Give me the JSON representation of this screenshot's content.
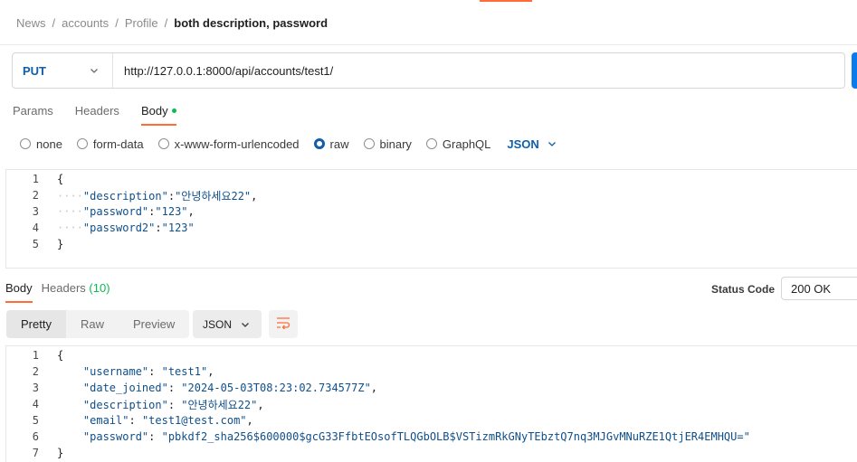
{
  "breadcrumb": {
    "items": [
      "News",
      "accounts",
      "Profile"
    ],
    "separator": "/",
    "current": "both description, password"
  },
  "request": {
    "method": "PUT",
    "url": "http://127.0.0.1:8000/api/accounts/test1/"
  },
  "request_tabs": {
    "params": "Params",
    "headers": "Headers",
    "body": "Body"
  },
  "body_types": {
    "none": "none",
    "form_data": "form-data",
    "urlencoded": "x-www-form-urlencoded",
    "raw": "raw",
    "binary": "binary",
    "graphql": "GraphQL",
    "format": "JSON",
    "selected": "raw"
  },
  "request_body": {
    "line_numbers": [
      "1",
      "2",
      "3",
      "4",
      "5"
    ],
    "open": "{",
    "close": "}",
    "fields": [
      {
        "key": "\"description\"",
        "value": "\"안녕하세요22\"",
        "comma": ","
      },
      {
        "key": "\"password\"",
        "value": "\"123\"",
        "comma": ","
      },
      {
        "key": "\"password2\"",
        "value": "\"123\"",
        "comma": ""
      }
    ]
  },
  "response_tabs": {
    "body": "Body",
    "headers": "Headers",
    "headers_count": "(10)"
  },
  "status": {
    "label": "Status Code",
    "value": "200 OK"
  },
  "view_modes": {
    "pretty": "Pretty",
    "raw": "Raw",
    "preview": "Preview",
    "format": "JSON"
  },
  "response_body": {
    "line_numbers": [
      "1",
      "2",
      "3",
      "4",
      "5",
      "6",
      "7"
    ],
    "open": "{",
    "close": "}",
    "fields": [
      {
        "key": "\"username\"",
        "value": "\"test1\"",
        "comma": ","
      },
      {
        "key": "\"date_joined\"",
        "value": "\"2024-05-03T08:23:02.734577Z\"",
        "comma": ","
      },
      {
        "key": "\"description\"",
        "value": "\"안녕하세요22\"",
        "comma": ","
      },
      {
        "key": "\"email\"",
        "value": "\"test1@test.com\"",
        "comma": ","
      },
      {
        "key": "\"password\"",
        "value": "\"pbkdf2_sha256$600000$gcG33FfbtEOsofTLQGbOLB$VSTizmRkGNyTEbztQ7nq3MJGvMNuRZE1QtjER4EMHQU=\"",
        "comma": ""
      }
    ]
  },
  "colors": {
    "accent": "#ff6c37",
    "method": "#0f5fa8",
    "send": "#097bed",
    "success": "#0cbb52"
  },
  "icons": {
    "method_dropdown": "chevron-down-icon",
    "format_dropdown": "chevron-down-icon",
    "wrap": "wrap-lines-icon"
  }
}
